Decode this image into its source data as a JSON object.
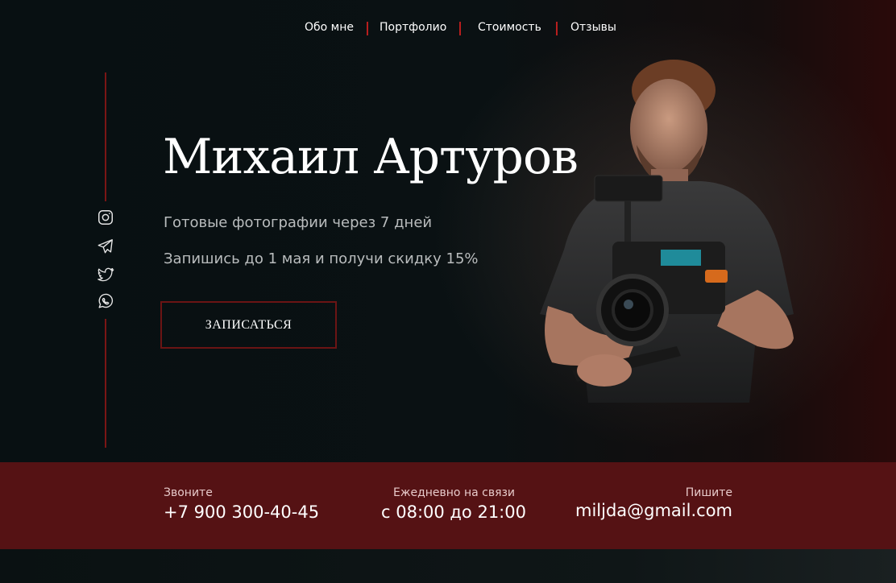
{
  "nav": {
    "items": [
      {
        "label": "Обо мне"
      },
      {
        "label": "Портфолио"
      },
      {
        "label": "Стоимость"
      },
      {
        "label": "Отзывы"
      }
    ]
  },
  "hero": {
    "title": "Михаил Артуров",
    "subtitle_1": "Готовые фотографии через 7 дней",
    "subtitle_2": "Запишись до 1 мая и получи скидку 15%",
    "cta_label": "ЗАПИСАТЬСЯ"
  },
  "social": {
    "icons": [
      "instagram-icon",
      "telegram-icon",
      "twitter-icon",
      "whatsapp-icon"
    ]
  },
  "contacts": {
    "call_label": "Звоните",
    "phone": "+7 900 300-40-45",
    "hours_label": "Ежедневно на связи",
    "hours": "с 08:00 до 21:00",
    "write_label": "Пишите",
    "email": "miljda@gmail.com"
  },
  "colors": {
    "accent": "#b81e1e",
    "contact_bar": "#551214",
    "background": "#0b1112"
  }
}
